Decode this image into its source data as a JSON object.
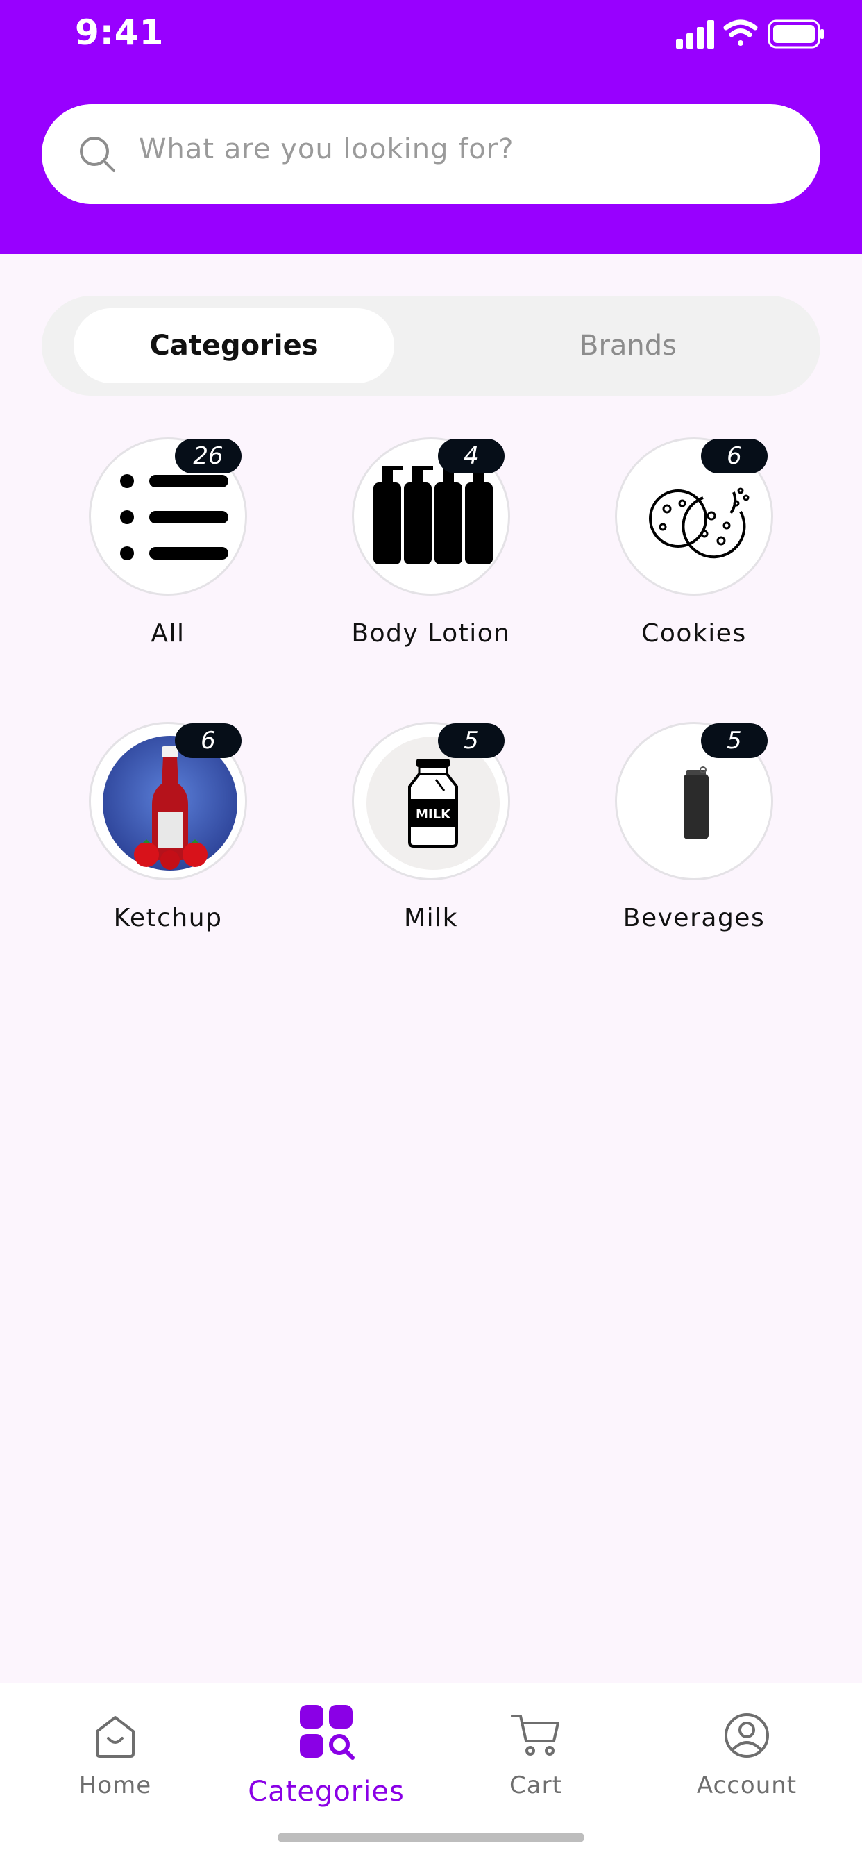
{
  "status_bar": {
    "time": "9:41"
  },
  "search": {
    "placeholder": "What are you looking for?"
  },
  "segments": {
    "active": "Categories",
    "inactive": "Brands"
  },
  "categories": [
    {
      "label": "All",
      "count": "26",
      "icon": "list-icon"
    },
    {
      "label": "Body Lotion",
      "count": "4",
      "icon": "lotion-bottles-icon"
    },
    {
      "label": "Cookies",
      "count": "6",
      "icon": "cookies-icon"
    },
    {
      "label": "Ketchup",
      "count": "6",
      "icon": "ketchup-bottle-image"
    },
    {
      "label": "Milk",
      "count": "5",
      "icon": "milk-jar-icon",
      "icon_text": "MILK"
    },
    {
      "label": "Beverages",
      "count": "5",
      "icon": "beverage-can-icon"
    }
  ],
  "nav": {
    "home": "Home",
    "categories": "Categories",
    "cart": "Cart",
    "account": "Account",
    "active": "categories"
  },
  "colors": {
    "brand": "#9800ff",
    "active_nav": "#8a00e6",
    "badge": "#060e18",
    "background": "#fcf5fd"
  }
}
